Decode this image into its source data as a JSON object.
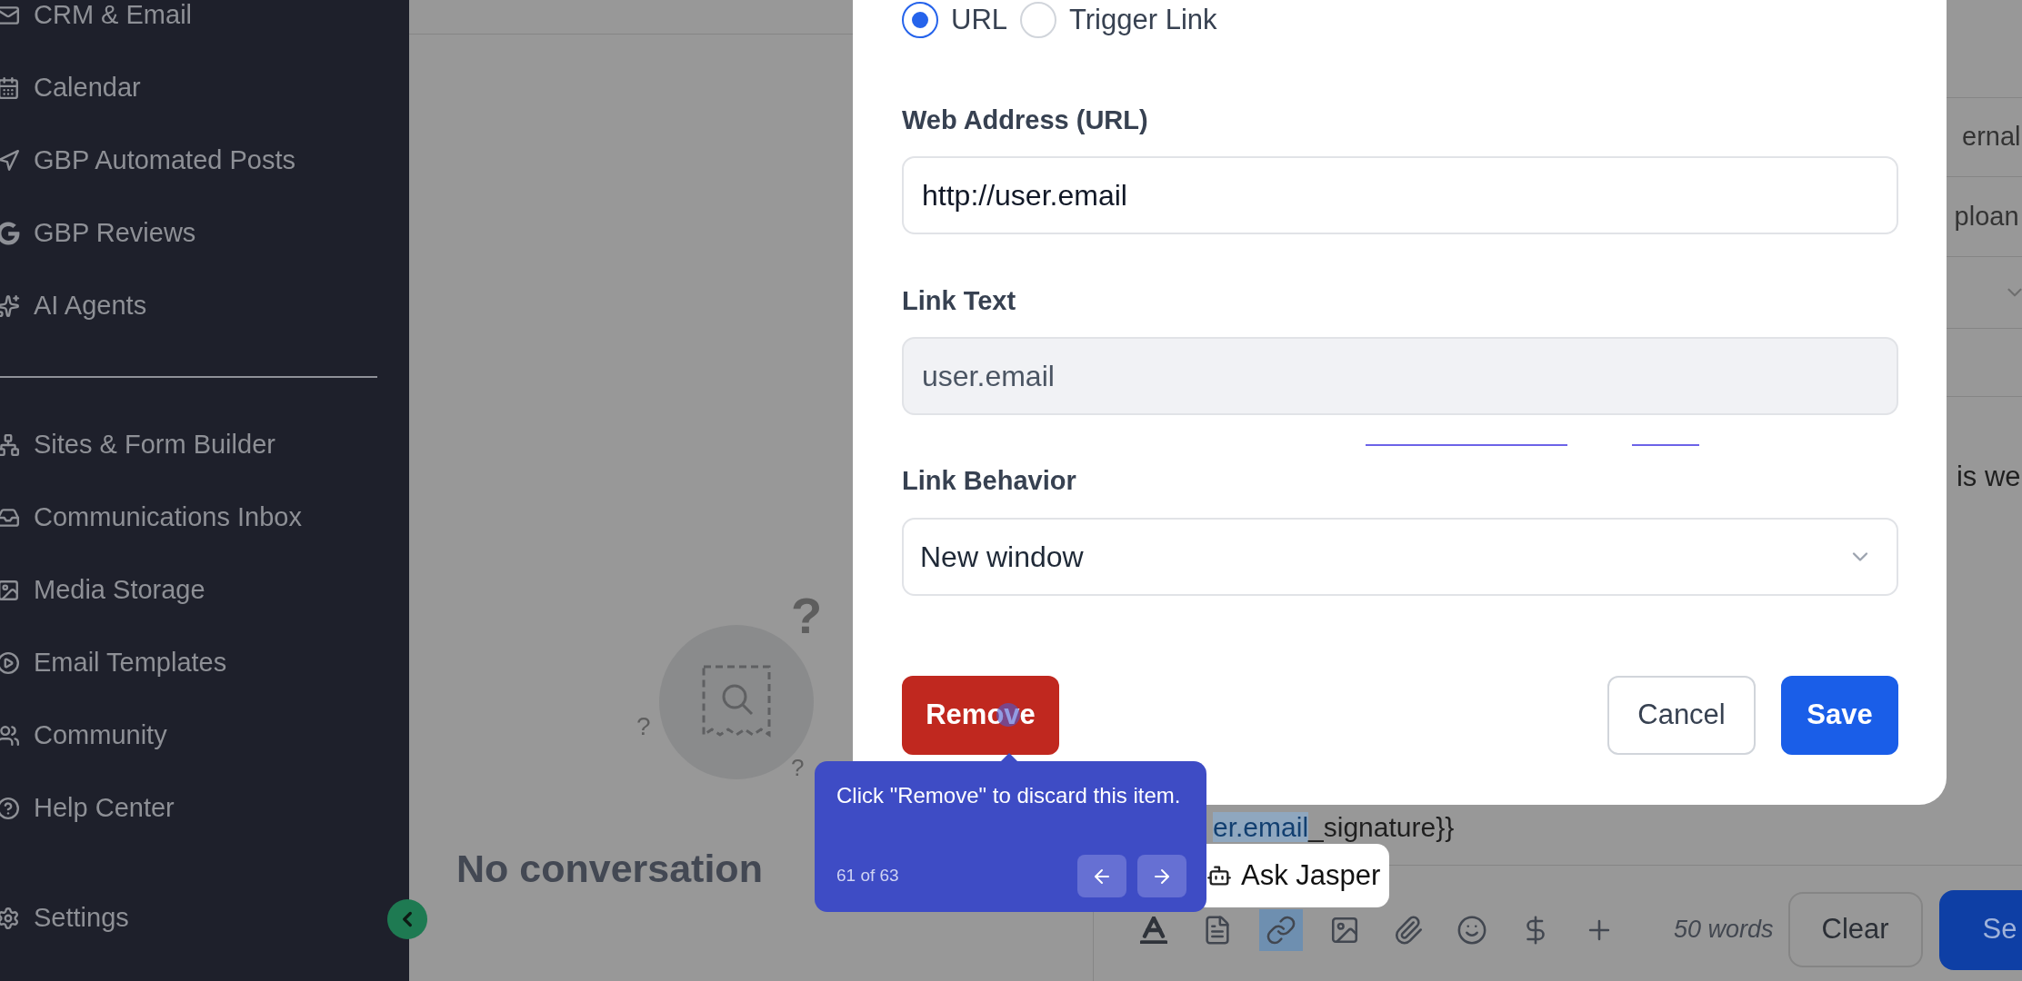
{
  "sidebar": {
    "items": [
      {
        "label": "CRM & Email"
      },
      {
        "label": "Calendar"
      },
      {
        "label": "GBP Automated Posts"
      },
      {
        "label": "GBP Reviews"
      },
      {
        "label": "AI Agents"
      },
      {
        "label": "Sites & Form Builder"
      },
      {
        "label": "Communications Inbox"
      },
      {
        "label": "Media Storage"
      },
      {
        "label": "Email Templates"
      },
      {
        "label": "Community"
      },
      {
        "label": "Help Center"
      },
      {
        "label": "Settings"
      }
    ]
  },
  "empty_state": {
    "marks": [
      "?",
      "?",
      "?"
    ],
    "title": "No conversation"
  },
  "conversation": {
    "rows": [
      "ernal",
      "ploan"
    ],
    "message_fragment": "is we",
    "signature": {
      "highlighted": "er.email",
      "rest": "_signature}}"
    },
    "ask_button": "Ask Jasper",
    "toolbar": [
      {
        "kind": "text-color",
        "selected": false
      },
      {
        "kind": "template",
        "selected": false
      },
      {
        "kind": "link",
        "selected": true
      },
      {
        "kind": "image",
        "selected": false
      },
      {
        "kind": "attachment",
        "selected": false
      },
      {
        "kind": "emoji",
        "selected": false
      },
      {
        "kind": "payment",
        "selected": false
      },
      {
        "kind": "more",
        "selected": false
      }
    ],
    "word_count": "50 words",
    "clear_button": "Clear",
    "send_button": "Se"
  },
  "modal": {
    "link_types": [
      {
        "label": "URL",
        "selected": true
      },
      {
        "label": "Trigger Link",
        "selected": false
      }
    ],
    "fields": [
      {
        "label": "Web Address (URL)",
        "value": "http://user.email",
        "disabled": false
      },
      {
        "label": "Link Text",
        "value": "user.email",
        "disabled": true
      }
    ],
    "behavior": {
      "label": "Link Behavior",
      "value": "New window"
    },
    "buttons": {
      "remove": "Remove",
      "cancel": "Cancel",
      "save": "Save"
    }
  },
  "tour_tip": {
    "text": "Click \"Remove\" to discard this item.",
    "progress": "61 of 63"
  }
}
